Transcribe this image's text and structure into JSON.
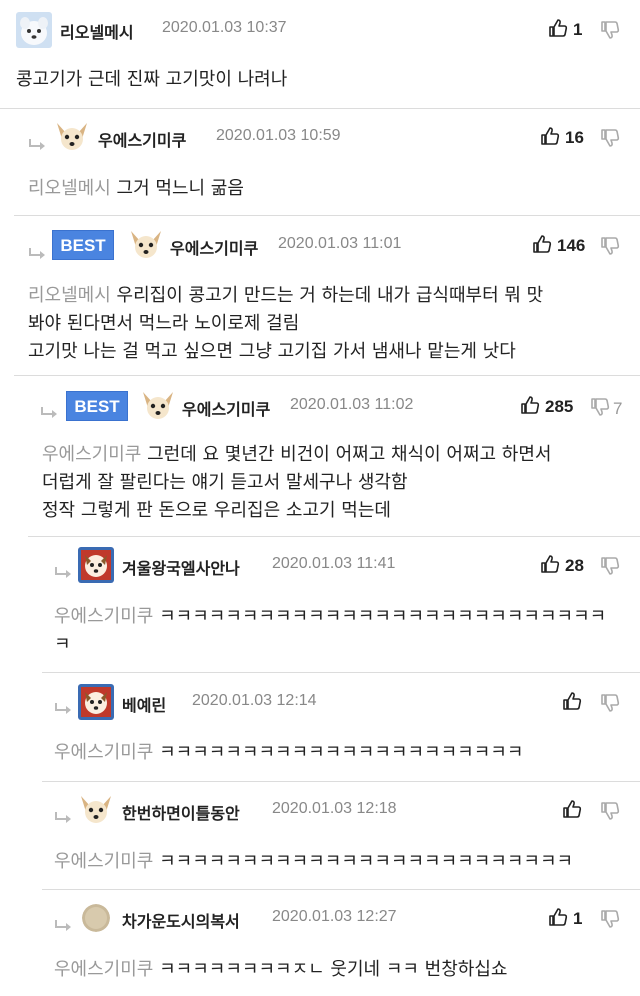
{
  "comments": [
    {
      "nickname": "리오넬메시",
      "datetime": "2020.01.03 10:37",
      "likes": "1",
      "dislikes": "",
      "best": false,
      "mention": "",
      "lines": [
        "콩고기가 근데 진짜 고기맛이 나려나"
      ],
      "avatar": "white-dog-avatar"
    },
    {
      "nickname": "우에스기미쿠",
      "datetime": "2020.01.03 10:59",
      "likes": "16",
      "dislikes": "",
      "best": false,
      "mention": "리오넬메시",
      "lines": [
        "그거 먹느니 굶음"
      ],
      "avatar": "chihuahua-avatar"
    },
    {
      "nickname": "우에스기미쿠",
      "datetime": "2020.01.03 11:01",
      "likes": "146",
      "dislikes": "",
      "best": true,
      "best_label": "BEST",
      "mention": "리오넬메시",
      "lines": [
        "우리집이 콩고기 만드는 거 하는데 내가 급식때부터 뭐 맛",
        "봐야 된다면서 먹느라 노이로제 걸림",
        "고기맛 나는 걸 먹고 싶으면 그냥 고기집 가서 냄새나 맡는게 낫다"
      ],
      "avatar": "chihuahua-avatar"
    },
    {
      "nickname": "우에스기미쿠",
      "datetime": "2020.01.03 11:02",
      "likes": "285",
      "dislikes": "7",
      "best": true,
      "best_label": "BEST",
      "mention": "우에스기미쿠",
      "lines": [
        "그런데 요 몇년간 비건이 어쩌고 채식이 어쩌고 하면서",
        "더럽게 잘 팔린다는 얘기 듣고서 말세구나 생각함",
        "정작 그렇게 판 돈으로 우리집은 소고기 먹는데"
      ],
      "avatar": "chihuahua-avatar"
    },
    {
      "nickname": "겨울왕국엘사안나",
      "datetime": "2020.01.03 11:41",
      "likes": "28",
      "dislikes": "",
      "best": false,
      "mention": "우에스기미쿠",
      "lines": [
        "ㅋㅋㅋㅋㅋㅋㅋㅋㅋㅋㅋㅋㅋㅋㅋㅋㅋㅋㅋㅋㅋㅋㅋㅋㅋㅋㅋ",
        "ㅋ"
      ],
      "avatar": "dog-red-frame-avatar"
    },
    {
      "nickname": "베예린",
      "datetime": "2020.01.03 12:14",
      "likes": "",
      "dislikes": "",
      "best": false,
      "mention": "우에스기미쿠",
      "lines": [
        "ㅋㅋㅋㅋㅋㅋㅋㅋㅋㅋㅋㅋㅋㅋㅋㅋㅋㅋㅋㅋㅋㅋ"
      ],
      "avatar": "dog-red-frame-avatar"
    },
    {
      "nickname": "한번하면이틀동안",
      "datetime": "2020.01.03 12:18",
      "likes": "",
      "dislikes": "",
      "best": false,
      "mention": "우에스기미쿠",
      "lines": [
        "ㅋㅋㅋㅋㅋㅋㅋㅋㅋㅋㅋㅋㅋㅋㅋㅋㅋㅋㅋㅋㅋㅋㅋㅋㅋ"
      ],
      "avatar": "chihuahua-avatar"
    },
    {
      "nickname": "차가운도시의복서",
      "datetime": "2020.01.03 12:27",
      "likes": "1",
      "dislikes": "",
      "best": false,
      "mention": "우에스기미쿠",
      "lines": [
        "ㅋㅋㅋㅋㅋㅋㅋㅋㅈㄴ 웃기네 ㅋㅋ 번창하십쇼"
      ],
      "avatar": "beige-circle-avatar"
    }
  ],
  "colors": {
    "best_badge": "#4a84e0",
    "mention": "#999999",
    "date": "#888888",
    "divider": "#dcdcdc"
  }
}
